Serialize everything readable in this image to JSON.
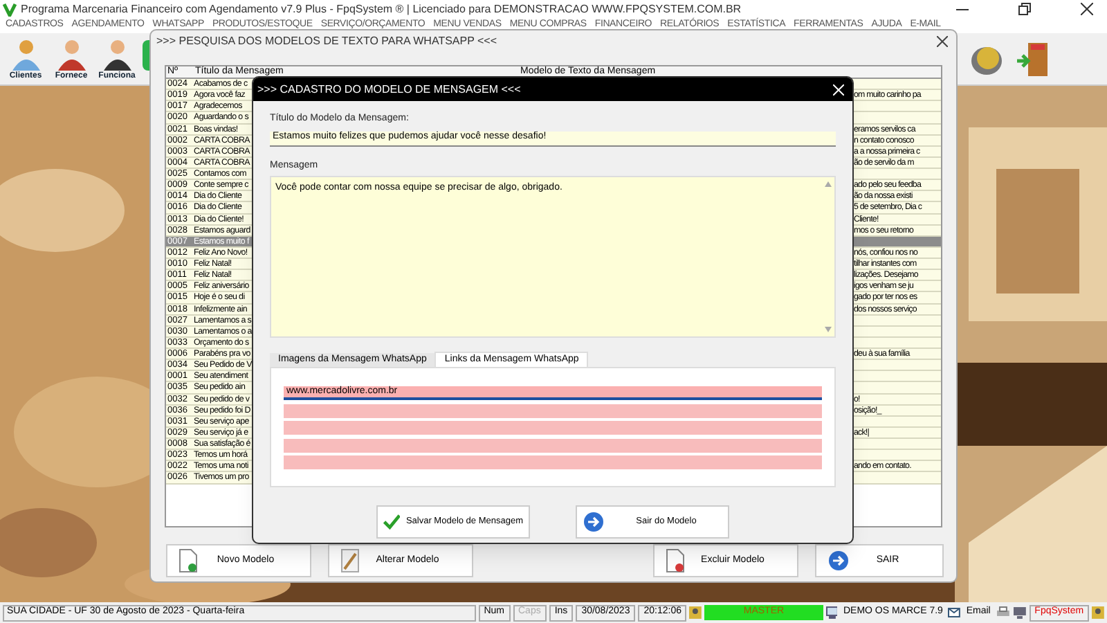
{
  "window": {
    "title": "Programa Marcenaria Financeiro com Agendamento v7.9 Plus - FpqSystem ® | Licenciado para  DEMONSTRACAO WWW.FPQSYSTEM.COM.BR"
  },
  "menu": [
    "CADASTROS",
    "AGENDAMENTO",
    "WHATSAPP",
    "PRODUTOS/ESTOQUE",
    "SERVIÇO/ORÇAMENTO",
    "MENU VENDAS",
    "MENU COMPRAS",
    "FINANCEIRO",
    "RELATÓRIOS",
    "ESTATÍSTICA",
    "FERRAMENTAS",
    "AJUDA",
    "E-MAIL"
  ],
  "toolbar": [
    {
      "label": "Clientes",
      "kind": "group"
    },
    {
      "label": "Fornece",
      "kind": "man"
    },
    {
      "label": "Funciona",
      "kind": "pair"
    }
  ],
  "search_window": {
    "title": ">>> PESQUISA DOS MODELOS DE TEXTO PARA WHATSAPP <<<",
    "columns": [
      "Nº",
      "Título da Mensagem",
      "Modelo de Texto da Mensagem"
    ],
    "rows": [
      {
        "number": "0024",
        "title": "Acabamos de c",
        "selected": false
      },
      {
        "number": "0019",
        "title": "Agora você faz",
        "model": "om muito carinho pa",
        "selected": false
      },
      {
        "number": "0017",
        "title": "Agradecemos",
        "selected": false
      },
      {
        "number": "0020",
        "title": "Aguardando o s",
        "selected": false
      },
      {
        "number": "0021",
        "title": "Boas vindas!",
        "model": "eramos servilos ca",
        "selected": false
      },
      {
        "number": "0002",
        "title": "CARTA COBRA",
        "model": "n contato conosco",
        "selected": false
      },
      {
        "number": "0003",
        "title": "CARTA COBRA",
        "model": "a a nossa primeira c",
        "selected": false
      },
      {
        "number": "0004",
        "title": "CARTA COBRA",
        "model": "ão de servilo da m",
        "selected": false
      },
      {
        "number": "0025",
        "title": "Contamos com",
        "selected": false
      },
      {
        "number": "0009",
        "title": "Conte sempre c",
        "model": "ado pelo seu feedba",
        "selected": false
      },
      {
        "number": "0014",
        "title": "Dia do Cliente",
        "model": "ão da nossa existi",
        "selected": false
      },
      {
        "number": "0016",
        "title": "Dia do Cliente",
        "model": "5 de setembro, Dia c",
        "selected": false
      },
      {
        "number": "0013",
        "title": "Dia do Cliente!",
        "model": "Cliente!",
        "selected": false
      },
      {
        "number": "0028",
        "title": "Estamos aguard",
        "model": "mos o seu retorno",
        "selected": false
      },
      {
        "number": "0007",
        "title": "Estamos muito f",
        "selected": true
      },
      {
        "number": "0012",
        "title": "Feliz Ano Novo!",
        "model": "nós, confiou nos no",
        "selected": false
      },
      {
        "number": "0010",
        "title": "Feliz Natal!",
        "model": "tilhar instantes com",
        "selected": false
      },
      {
        "number": "0011",
        "title": "Feliz Natal!",
        "model": "lizações. Desejamo",
        "selected": false
      },
      {
        "number": "0005",
        "title": "Feliz aniversário",
        "model": "igos venham se ju",
        "selected": false
      },
      {
        "number": "0015",
        "title": "Hoje é o seu di",
        "model": "gado por ter nos es",
        "selected": false
      },
      {
        "number": "0018",
        "title": "Infelizmente ain",
        "model": "dos nossos serviço",
        "selected": false
      },
      {
        "number": "0027",
        "title": "Lamentamos a s",
        "selected": false
      },
      {
        "number": "0030",
        "title": "Lamentamos o a",
        "selected": false
      },
      {
        "number": "0033",
        "title": "Orçamento do s",
        "selected": false
      },
      {
        "number": "0006",
        "title": "Parabéns pra vo",
        "model": "deu à sua família",
        "selected": false
      },
      {
        "number": "0034",
        "title": "Seu Pedido de V",
        "selected": false
      },
      {
        "number": "0001",
        "title": "Seu atendiment",
        "selected": false
      },
      {
        "number": "0035",
        "title": "Seu pedido ain",
        "selected": false
      },
      {
        "number": "0032",
        "title": "Seu pedido de v",
        "model": "o!",
        "selected": false
      },
      {
        "number": "0036",
        "title": "Seu pedido foi D",
        "model": "osição!_",
        "selected": false
      },
      {
        "number": "0031",
        "title": "Seu serviço ape",
        "selected": false
      },
      {
        "number": "0029",
        "title": "Seu serviço já e",
        "model": "ack!|",
        "selected": false
      },
      {
        "number": "0008",
        "title": "Sua satisfação é",
        "selected": false
      },
      {
        "number": "0023",
        "title": "Temos um horá",
        "selected": false
      },
      {
        "number": "0022",
        "title": "Temos uma noti",
        "model": "ando em contato.",
        "selected": false
      },
      {
        "number": "0026",
        "title": "Tivemos um pro",
        "selected": false
      }
    ],
    "buttons": [
      {
        "label": "Novo Modelo",
        "kind": "new"
      },
      {
        "label": "Alterar Modelo",
        "kind": "edit"
      },
      {
        "label": "Excluir Modelo",
        "kind": "delete"
      },
      {
        "label": "SAIR",
        "kind": "exit"
      }
    ]
  },
  "dialog": {
    "title": ">>> CADASTRO DO MODELO DE MENSAGEM <<<",
    "title_label": "Título do Modelo da Mensagem:",
    "title_value": "Estamos muito felizes que pudemos ajudar você nesse desafio!",
    "message_label": "Mensagem",
    "message_value": "Você pode contar com nossa equipe se precisar de algo, obrigado.",
    "tabs": [
      {
        "label": "Imagens da Mensagem WhatsApp",
        "selected": false
      },
      {
        "label": "Links da Mensagem WhatsApp",
        "selected": true
      }
    ],
    "links": [
      {
        "value": "www.mercadolivre.com.br",
        "focused": true
      },
      {
        "focused": false
      },
      {
        "focused": false
      },
      {
        "focused": false
      },
      {
        "focused": false
      }
    ],
    "buttons": [
      {
        "label": "Salvar Modelo de Mensagem",
        "kind": "save"
      },
      {
        "label": "Sair do Modelo",
        "kind": "exit"
      }
    ]
  },
  "status_bar": {
    "location": "SUA CIDADE - UF 30 de Agosto de 2023 - Quarta-feira",
    "keys": [
      {
        "text": "Num",
        "enabled": true
      },
      {
        "text": "Caps",
        "enabled": false
      },
      {
        "text": "Ins",
        "enabled": true
      }
    ],
    "date": "30/08/2023",
    "time": "20:12:06",
    "user": "MASTER",
    "company": "DEMO OS MARCE 7.9",
    "email": "Email",
    "brand": "FpqSystem"
  }
}
